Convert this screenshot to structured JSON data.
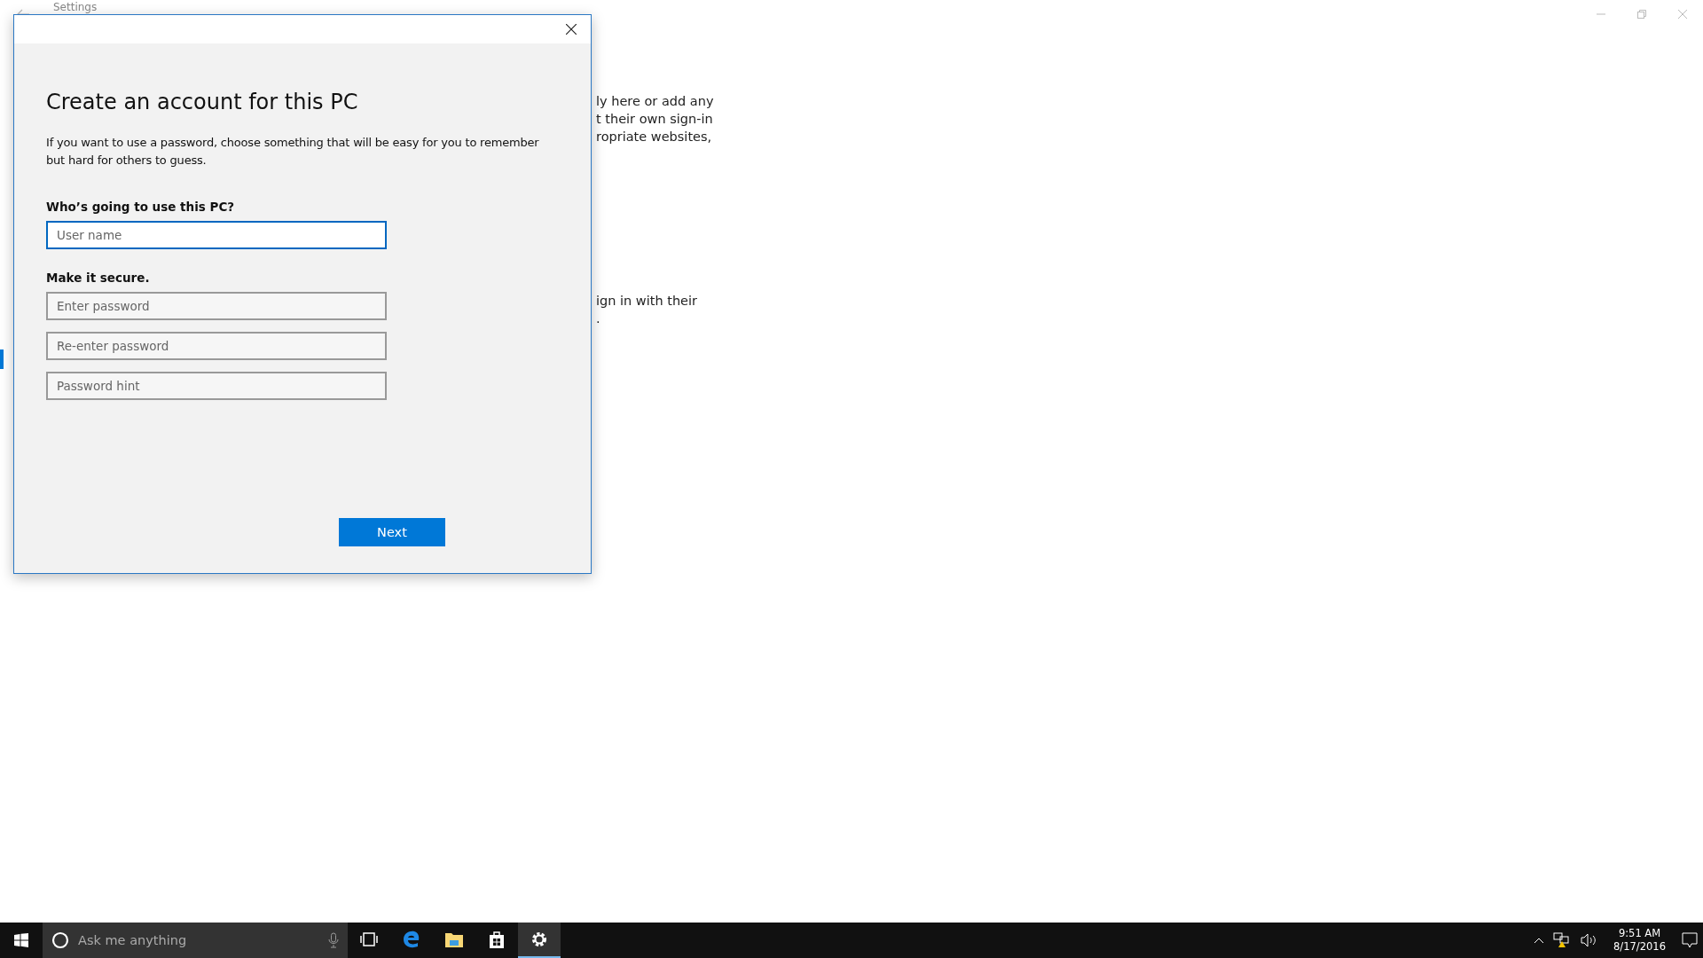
{
  "window": {
    "title": "Settings"
  },
  "background_text": [
    {
      "lines": [
        "ly here or add any",
        "t their own sign-in",
        "ropriate websites,"
      ]
    },
    {
      "lines": [
        "ign in with their",
        "."
      ]
    }
  ],
  "dialog": {
    "heading": "Create an account for this PC",
    "description": "If you want to use a password, choose something that will be easy for you to remember but hard for others to guess.",
    "sections": [
      {
        "label": "Who’s going to use this PC?",
        "fields": [
          {
            "placeholder": "User name",
            "focused": true
          }
        ]
      },
      {
        "label": "Make it secure.",
        "fields": [
          {
            "placeholder": "Enter password",
            "focused": false
          },
          {
            "placeholder": "Re-enter password",
            "focused": false
          },
          {
            "placeholder": "Password hint",
            "focused": false
          }
        ]
      }
    ],
    "button": "Next"
  },
  "taskbar": {
    "search": {
      "placeholder": "Ask me anything"
    },
    "apps": [
      {
        "kind": "taskview",
        "selected": false
      },
      {
        "kind": "browser",
        "selected": false
      },
      {
        "kind": "folder",
        "selected": false
      },
      {
        "kind": "store",
        "selected": false
      },
      {
        "kind": "settings",
        "selected": true
      }
    ],
    "clock": {
      "time": "9:51 AM",
      "date": "8/17/2016"
    }
  }
}
